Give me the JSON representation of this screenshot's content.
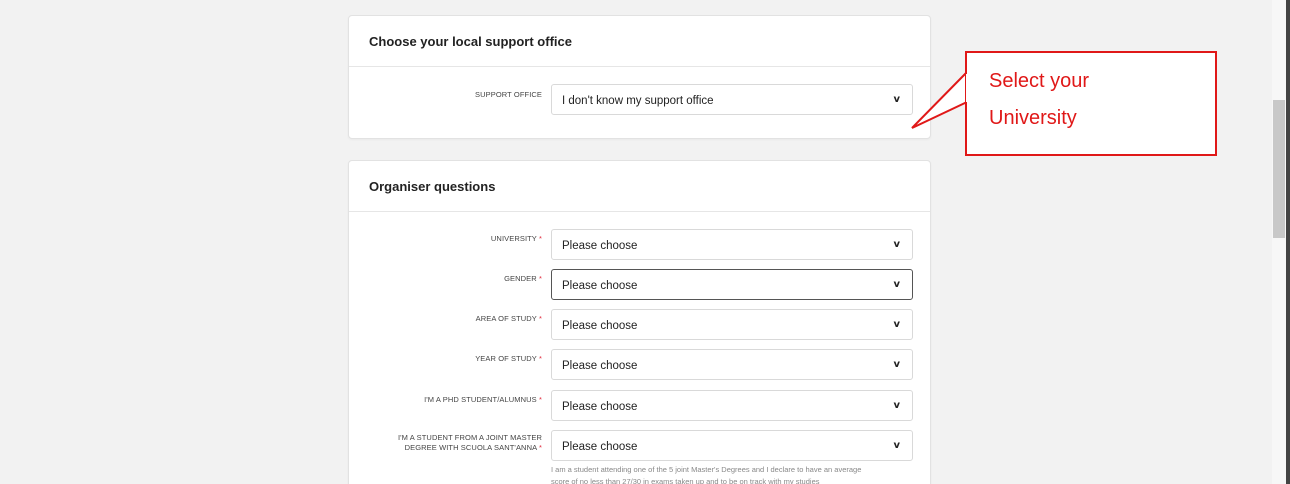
{
  "support_card": {
    "title": "Choose your local support office",
    "field": {
      "label": "SUPPORT OFFICE",
      "value": "I don't know my support office"
    }
  },
  "organiser_card": {
    "title": "Organiser questions",
    "required_marker": "*",
    "fields": [
      {
        "label": "UNIVERSITY",
        "value": "Please choose"
      },
      {
        "label": "GENDER",
        "value": "Please choose"
      },
      {
        "label": "AREA OF STUDY",
        "value": "Please choose"
      },
      {
        "label": "YEAR OF STUDY",
        "value": "Please choose"
      },
      {
        "label": "I'M A PHD STUDENT/ALUMNUS",
        "value": "Please choose"
      },
      {
        "label_line1": "I'M A STUDENT FROM A JOINT MASTER",
        "label_line2": "DEGREE WITH SCUOLA SANT'ANNA",
        "value": "Please choose"
      }
    ],
    "helper_line1": "I am a student attending one of the 5 joint Master's Degrees and I declare to have an average",
    "helper_line2": "score of no less than 27/30 in exams taken up and to be on track with my studies"
  },
  "callout": {
    "line1": "Select your",
    "line2": "University"
  },
  "icons": {
    "chevron": "chevron-down-icon"
  },
  "colors": {
    "callout_red": "#e01818",
    "required_red": "#e0293c",
    "page_bg": "#f2f2f2"
  }
}
